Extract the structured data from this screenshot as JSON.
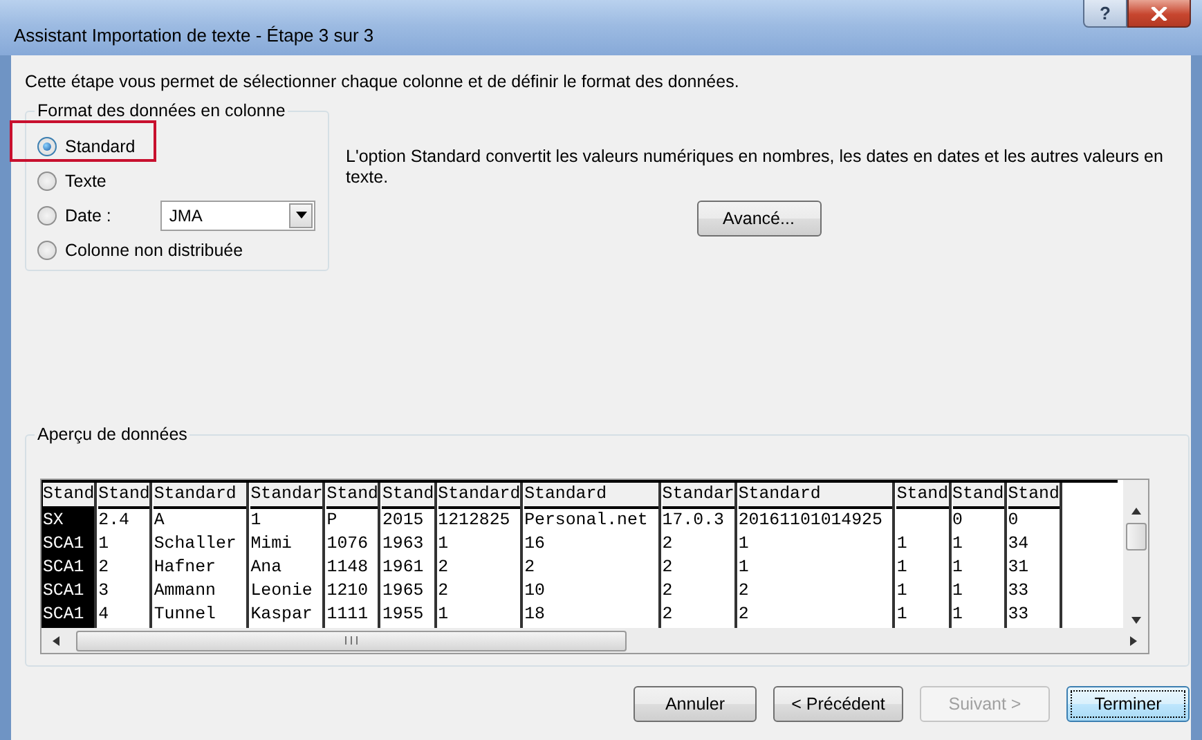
{
  "window": {
    "title": "Assistant Importation de texte - Étape 3 sur 3",
    "help_button": "?"
  },
  "intro": "Cette étape vous permet de sélectionner chaque colonne et de définir le format des données.",
  "format_group": {
    "title": "Format des données en colonne",
    "options": [
      {
        "kind": "plain",
        "label": "Standard",
        "selected": true,
        "highlighted": true
      },
      {
        "kind": "plain",
        "label": "Texte",
        "selected": false,
        "highlighted": false
      },
      {
        "kind": "date",
        "label": "Date :",
        "selected": false,
        "highlighted": false,
        "dropdown_value": "JMA"
      },
      {
        "kind": "plain",
        "label": "Colonne non distribuée",
        "selected": false,
        "highlighted": false
      }
    ]
  },
  "description": "L'option Standard convertit les valeurs numériques en nombres, les dates en dates et les autres valeurs en texte.",
  "advanced_button": "Avancé...",
  "preview": {
    "title": "Aperçu de données",
    "columns": [
      {
        "header": "Stand",
        "selected": true
      },
      {
        "header": "Stand",
        "selected": false
      },
      {
        "header": "Standard",
        "selected": false
      },
      {
        "header": "Standar",
        "selected": false
      },
      {
        "header": "Stand",
        "selected": false
      },
      {
        "header": "Stand",
        "selected": false
      },
      {
        "header": "Standard",
        "selected": false
      },
      {
        "header": "Standard",
        "selected": false
      },
      {
        "header": "Standar",
        "selected": false
      },
      {
        "header": "Standard",
        "selected": false
      },
      {
        "header": "Stand",
        "selected": false
      },
      {
        "header": "Stand",
        "selected": false
      },
      {
        "header": "Stand",
        "selected": false
      }
    ],
    "rows": [
      [
        "SX",
        "2.4",
        "A",
        "1",
        "P",
        "2015",
        "1212825",
        "Personal.net",
        "17.0.3",
        "20161101014925",
        null,
        "0",
        "0"
      ],
      [
        "SCA1",
        "1",
        "Schaller",
        "Mimi",
        "1076",
        "1963",
        "1",
        "16",
        "2",
        "1",
        "1",
        "1",
        "34"
      ],
      [
        "SCA1",
        "2",
        "Hafner",
        "Ana",
        "1148",
        "1961",
        "2",
        "2",
        "2",
        "1",
        "1",
        "1",
        "31"
      ],
      [
        "SCA1",
        "3",
        "Ammann",
        "Leonie",
        "1210",
        "1965",
        "2",
        "10",
        "2",
        "2",
        "1",
        "1",
        "33"
      ],
      [
        "SCA1",
        "4",
        "Tunnel",
        "Kaspar",
        "1111",
        "1955",
        "1",
        "18",
        "2",
        "2",
        "1",
        "1",
        "33"
      ]
    ]
  },
  "buttons": [
    {
      "label": "Annuler",
      "disabled": false,
      "default": false
    },
    {
      "label": "< Précédent",
      "disabled": false,
      "default": false
    },
    {
      "label": "Suivant >",
      "disabled": true,
      "default": false
    },
    {
      "label": "Terminer",
      "disabled": false,
      "default": true
    }
  ]
}
